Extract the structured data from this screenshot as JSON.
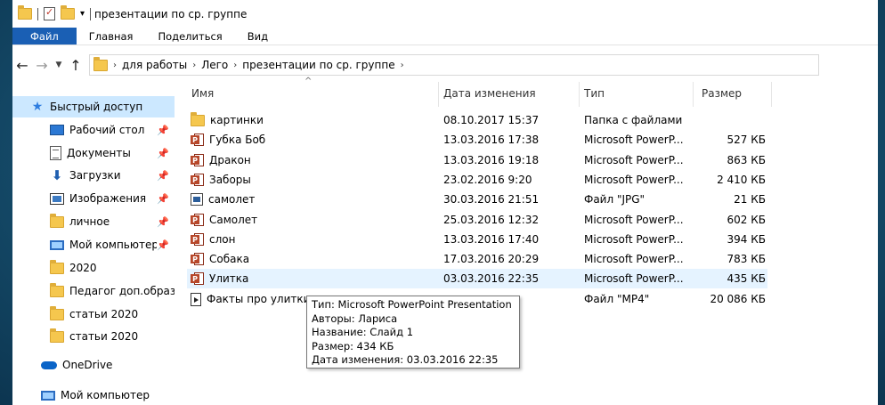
{
  "window": {
    "title": "презентации по ср. группе"
  },
  "ribbon": {
    "tabs": [
      "Файл",
      "Главная",
      "Поделиться",
      "Вид"
    ]
  },
  "address": {
    "crumbs": [
      "для работы",
      "Лего",
      "презентации по ср. группе"
    ]
  },
  "columns": {
    "name": "Имя",
    "date": "Дата изменения",
    "type": "Тип",
    "size": "Размер"
  },
  "sidebar": {
    "items": [
      {
        "label": "Быстрый доступ",
        "icon": "star-icon"
      },
      {
        "label": "Рабочий стол",
        "icon": "desktop-icon",
        "pinned": true
      },
      {
        "label": "Документы",
        "icon": "documents-icon",
        "pinned": true
      },
      {
        "label": "Загрузки",
        "icon": "download-icon",
        "pinned": true
      },
      {
        "label": "Изображения",
        "icon": "pictures-icon",
        "pinned": true
      },
      {
        "label": "личное",
        "icon": "folder-icon",
        "pinned": true
      },
      {
        "label": "Мой компьютер",
        "icon": "computer-icon",
        "pinned": true
      },
      {
        "label": "2020",
        "icon": "folder-icon"
      },
      {
        "label": "Педагог доп.образ",
        "icon": "folder-icon"
      },
      {
        "label": "статьи 2020",
        "icon": "folder-icon"
      },
      {
        "label": "статьи 2020",
        "icon": "folder-icon"
      },
      {
        "label": "OneDrive",
        "icon": "onedrive-icon"
      },
      {
        "label": "Мой компьютер",
        "icon": "computer-icon"
      }
    ]
  },
  "files": [
    {
      "name": "картинки",
      "date": "08.10.2017 15:37",
      "type": "Папка с файлами",
      "size": "",
      "icon": "folder-icon"
    },
    {
      "name": "Губка Боб",
      "date": "13.03.2016 17:38",
      "type": "Microsoft PowerP...",
      "size": "527 КБ",
      "icon": "ppt-icon"
    },
    {
      "name": "Дракон",
      "date": "13.03.2016 19:18",
      "type": "Microsoft PowerP...",
      "size": "863 КБ",
      "icon": "ppt-icon"
    },
    {
      "name": "Заборы",
      "date": "23.02.2016 9:20",
      "type": "Microsoft PowerP...",
      "size": "2 410 КБ",
      "icon": "ppt-icon"
    },
    {
      "name": "самолет",
      "date": "30.03.2016 21:51",
      "type": "Файл \"JPG\"",
      "size": "21 КБ",
      "icon": "image-icon"
    },
    {
      "name": "Самолет",
      "date": "25.03.2016 12:32",
      "type": "Microsoft PowerP...",
      "size": "602 КБ",
      "icon": "ppt-icon"
    },
    {
      "name": "слон",
      "date": "13.03.2016 17:40",
      "type": "Microsoft PowerP...",
      "size": "394 КБ",
      "icon": "ppt-icon"
    },
    {
      "name": "Собака",
      "date": "17.03.2016 20:29",
      "type": "Microsoft PowerP...",
      "size": "783 КБ",
      "icon": "ppt-icon"
    },
    {
      "name": "Улитка",
      "date": "03.03.2016 22:35",
      "type": "Microsoft PowerP...",
      "size": "435 КБ",
      "icon": "ppt-icon",
      "hover": true
    },
    {
      "name": "Факты про улитки",
      "date": "",
      "type": "Файл \"MP4\"",
      "size": "20 086 КБ",
      "icon": "video-icon"
    }
  ],
  "tooltip": {
    "lines": [
      "Тип: Microsoft PowerPoint Presentation",
      "Авторы: Лариса",
      "Название: Слайд 1",
      "Размер: 434 КБ",
      "Дата изменения: 03.03.2016 22:35"
    ]
  },
  "colors": {
    "file_tab": "#1a5fb4",
    "selected": "#cce8ff",
    "hover": "#e5f3ff",
    "desktop_bg": "#17506f"
  }
}
